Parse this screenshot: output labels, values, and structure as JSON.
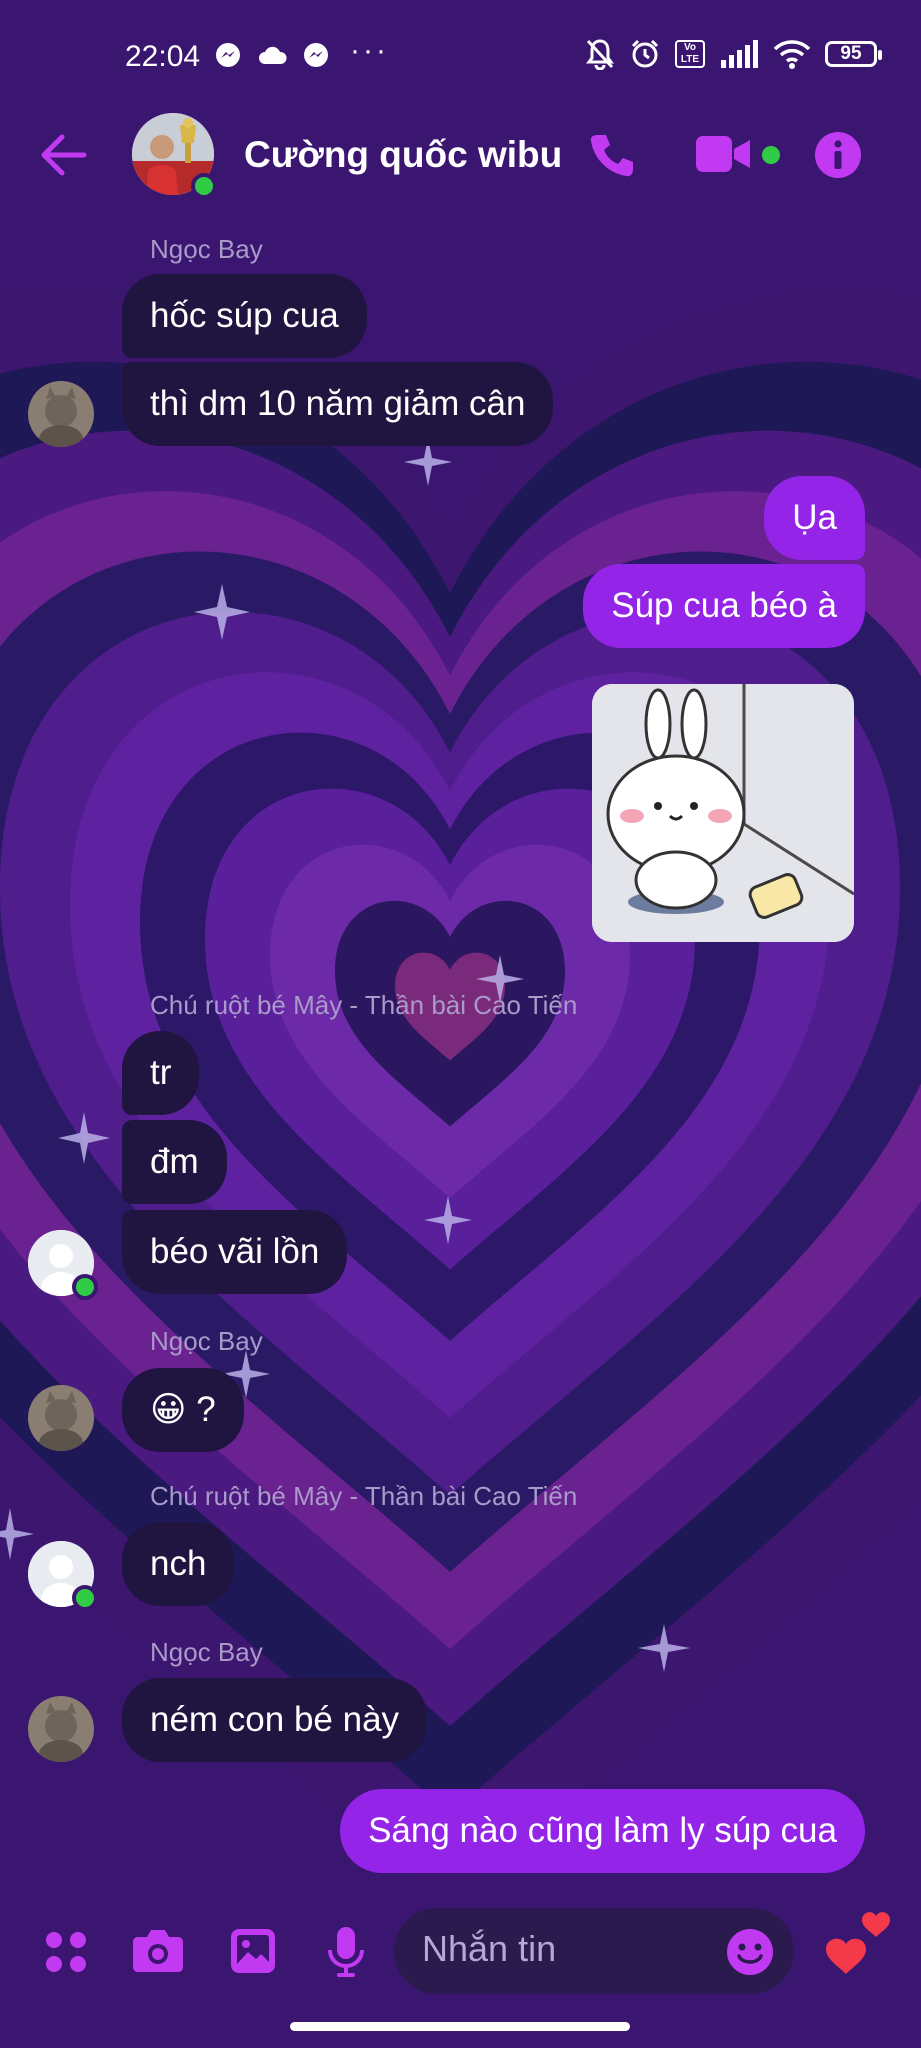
{
  "status_bar": {
    "time": "22:04",
    "volte": "Vo LTE",
    "battery": "95",
    "more": "···"
  },
  "header": {
    "title": "Cường quốc wibu",
    "accent_color": "#c13af2"
  },
  "messages": [
    {
      "sender": "Ngọc Bay"
    },
    {
      "text": "hốc súp cua"
    },
    {
      "text": "thì dm 10 năm giảm cân"
    },
    {
      "text": "Ụa"
    },
    {
      "text": "Súp cua béo à"
    },
    {
      "sender": "Chú ruột bé Mây - Thần bài Cao Tiến"
    },
    {
      "text": "tr"
    },
    {
      "text": "đm"
    },
    {
      "text": "béo vãi lồn"
    },
    {
      "sender": "Ngọc Bay"
    },
    {
      "text": "😀 ?"
    },
    {
      "sender": "Chú ruột bé Mây - Thần bài Cao Tiến"
    },
    {
      "text": "nch"
    },
    {
      "sender": "Ngọc Bay"
    },
    {
      "text": "ném con bé này"
    },
    {
      "text": "Sáng nào cũng làm ly súp cua"
    }
  ],
  "composer": {
    "placeholder": "Nhắn tin"
  },
  "colors": {
    "background": "#3a1670",
    "incoming_bubble": "#1f1540",
    "outgoing_bubble": "#9425e8",
    "icon_accent": "#c13af2",
    "online": "#31cc46"
  }
}
